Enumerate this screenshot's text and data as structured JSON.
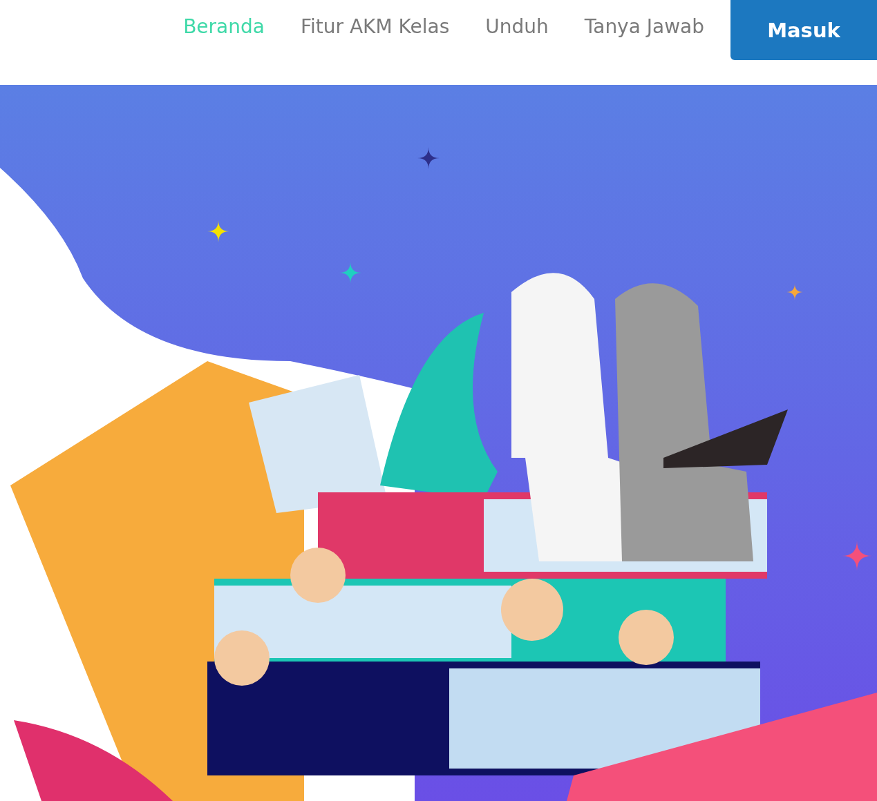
{
  "nav": {
    "items": [
      {
        "label": "Beranda",
        "selected": true
      },
      {
        "label": "Fitur AKM Kelas",
        "selected": false
      },
      {
        "label": "Unduh",
        "selected": false
      },
      {
        "label": "Tanya Jawab",
        "selected": false
      }
    ],
    "login_button": "Masuk"
  }
}
